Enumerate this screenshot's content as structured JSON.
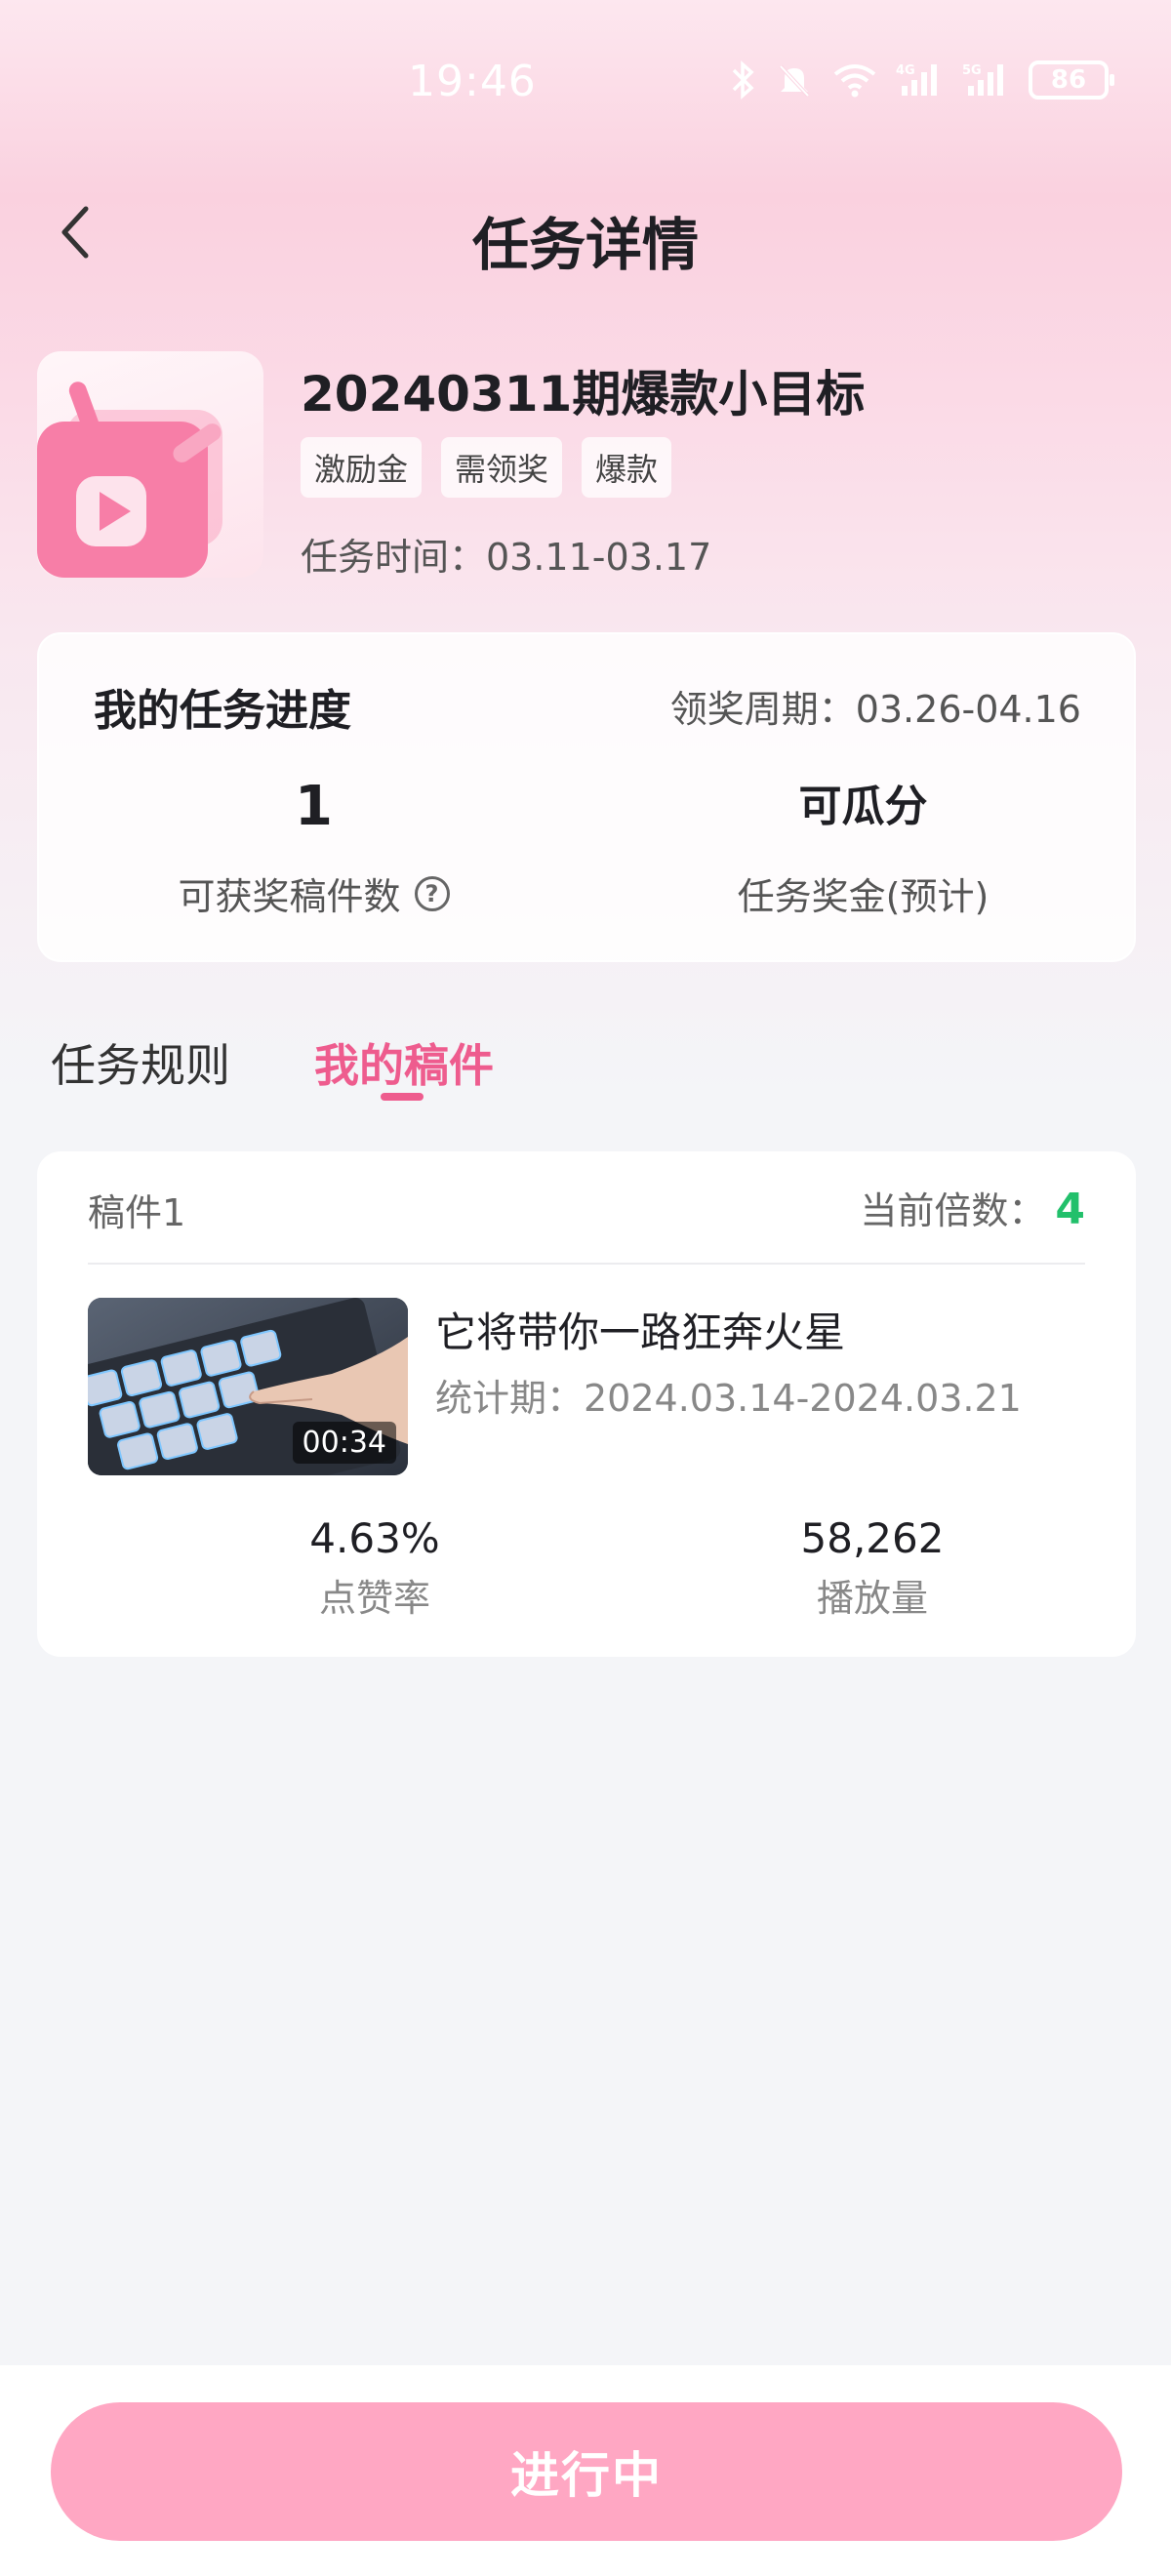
{
  "status_bar": {
    "time": "19:46",
    "battery": "86",
    "icons": [
      "bluetooth-icon",
      "mute-icon",
      "wifi-icon",
      "signal-4g-icon",
      "signal-5g-icon",
      "battery-icon"
    ]
  },
  "nav": {
    "title": "任务详情",
    "back_icon": "chevron-left-icon"
  },
  "task": {
    "name": "20240311期爆款小目标",
    "tags": [
      "激励金",
      "需领奖",
      "爆款"
    ],
    "time_text": "任务时间：03.11-03.17"
  },
  "progress": {
    "title": "我的任务进度",
    "period_text": "领奖周期：03.26-04.16",
    "awardable_count": "1",
    "awardable_label": "可获奖稿件数",
    "bonus_value": "可瓜分",
    "bonus_label": "任务奖金(预计)"
  },
  "tabs": [
    {
      "label": "任务规则",
      "active": false
    },
    {
      "label": "我的稿件",
      "active": true
    }
  ],
  "submission": {
    "label": "稿件1",
    "multiplier_label": "当前倍数：",
    "multiplier_value": "4",
    "duration": "00:34",
    "title": "它将带你一路狂奔火星",
    "period_text": "统计期：2024.03.14-2024.03.21",
    "like_rate": "4.63%",
    "like_rate_label": "点赞率",
    "plays": "58,262",
    "plays_label": "播放量"
  },
  "bottom": {
    "status_button": "进行中"
  },
  "colors": {
    "accent": "#ee5c8e",
    "multiplier": "#22c06b",
    "button": "#ffa7c3"
  }
}
